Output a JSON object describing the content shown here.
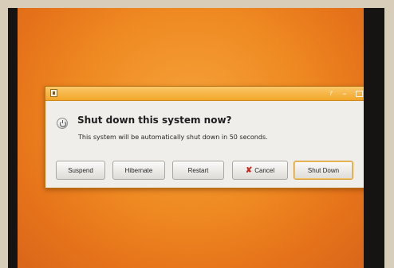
{
  "dialog": {
    "titlebar_buttons": {
      "help": "?",
      "minimize": "–",
      "close": "✕"
    },
    "title": "Shut down this system now?",
    "message": "This system will be automatically shut down in 50 seconds.",
    "buttons": {
      "suspend": "Suspend",
      "hibernate": "Hibernate",
      "restart": "Restart",
      "cancel": "Cancel",
      "shutdown": "Shut Down"
    },
    "icons": {
      "window": "window-icon",
      "power": "power-icon",
      "cancel": "cancel-icon"
    }
  },
  "colors": {
    "desktop": "#ef8a22",
    "titlebar": "#f2a629",
    "dialog_background": "#efeeea"
  }
}
